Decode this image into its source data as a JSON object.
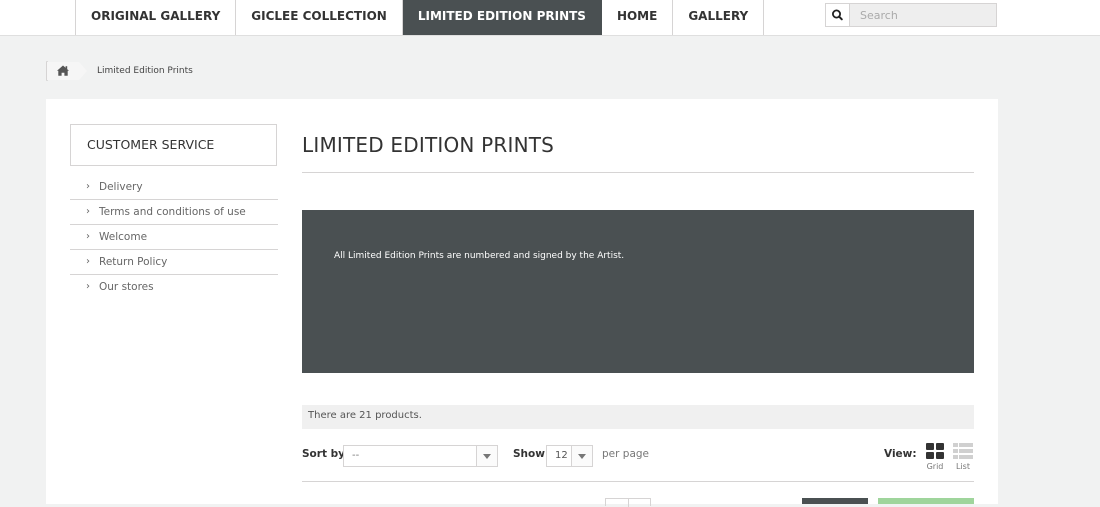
{
  "nav": {
    "items": [
      {
        "label": "ORIGINAL GALLERY",
        "active": false
      },
      {
        "label": "GICLEE COLLECTION",
        "active": false
      },
      {
        "label": "LIMITED EDITION PRINTS",
        "active": true
      },
      {
        "label": "HOME",
        "active": false
      },
      {
        "label": "GALLERY",
        "active": false
      }
    ]
  },
  "search": {
    "placeholder": "Search",
    "icon": "search-icon"
  },
  "breadcrumb": {
    "home_icon": "home-icon",
    "current": "Limited Edition Prints"
  },
  "sidebar": {
    "title": "CUSTOMER SERVICE",
    "items": [
      {
        "label": "Delivery"
      },
      {
        "label": "Terms and conditions of use"
      },
      {
        "label": "Welcome"
      },
      {
        "label": "Return Policy"
      },
      {
        "label": "Our stores"
      }
    ]
  },
  "category": {
    "title": "LIMITED EDITION PRINTS",
    "description": "All Limited Edition Prints are numbered and signed by the Artist.",
    "product_count_text": "There are 21 products."
  },
  "toolbar": {
    "sort_label": "Sort by",
    "sort_value": "--",
    "show_label": "Show",
    "show_value": "12",
    "per_page_label": "per page",
    "view_label": "View:",
    "grid_label": "Grid",
    "list_label": "List",
    "grid_icon": "grid-view-icon",
    "list_icon": "list-view-icon"
  },
  "colors": {
    "accent_dark": "#4a5052",
    "page_bg": "#f1f2f2",
    "border": "#d6d4d4",
    "green_button": "#9fd59c"
  }
}
